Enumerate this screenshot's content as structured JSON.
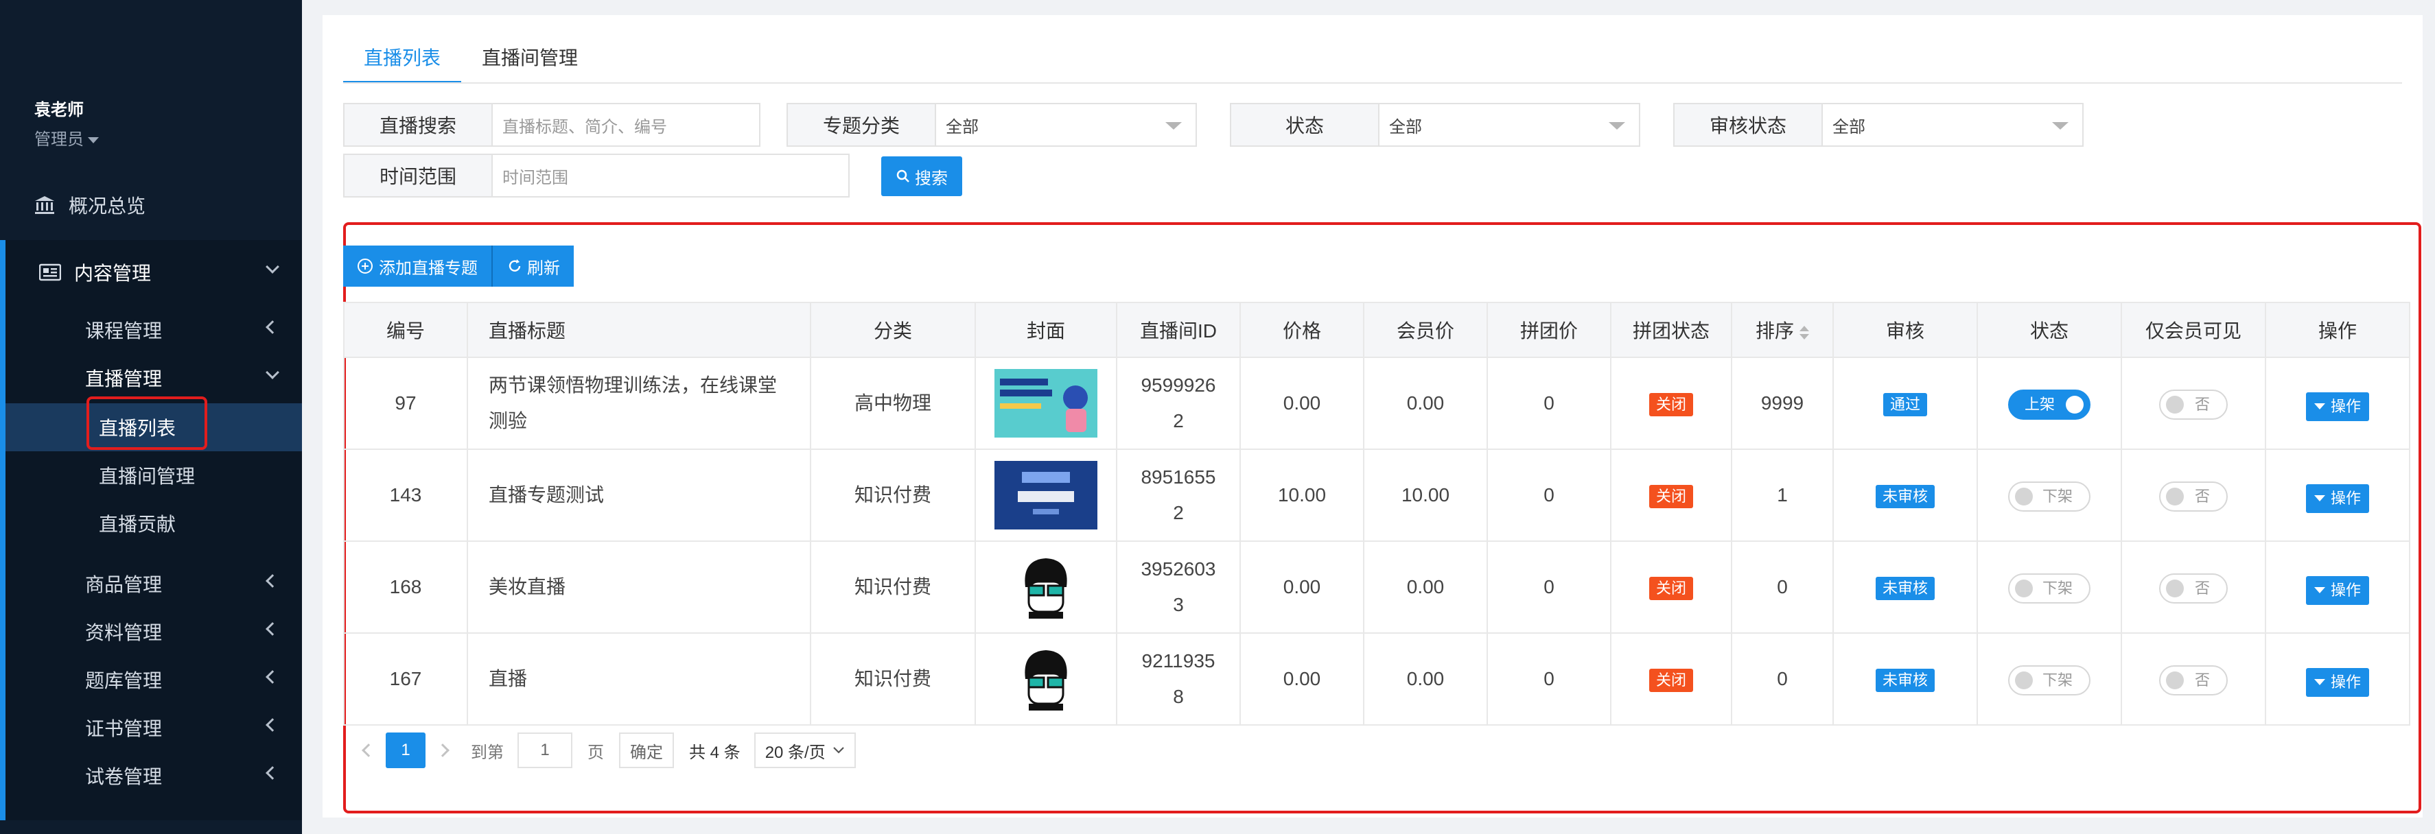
{
  "sidebar": {
    "user_name": "袁老师",
    "user_role": "管理员",
    "overview": "概况总览",
    "content_mgmt": "内容管理",
    "items": {
      "course": "课程管理",
      "live": "直播管理",
      "live_list": "直播列表",
      "live_room": "直播间管理",
      "live_contrib": "直播贡献",
      "goods": "商品管理",
      "material": "资料管理",
      "question": "题库管理",
      "cert": "证书管理",
      "exam": "试卷管理"
    }
  },
  "tabs": {
    "live_list": "直播列表",
    "live_room": "直播间管理"
  },
  "filters": {
    "search_label": "直播搜索",
    "search_placeholder": "直播标题、简介、编号",
    "category_label": "专题分类",
    "category_value": "全部",
    "status_label": "状态",
    "status_value": "全部",
    "audit_label": "审核状态",
    "audit_value": "全部",
    "time_label": "时间范围",
    "time_placeholder": "时间范围",
    "search_button": "搜索"
  },
  "toolbar": {
    "add": "添加直播专题",
    "refresh": "刷新"
  },
  "table": {
    "headers": {
      "id": "编号",
      "title": "直播标题",
      "category": "分类",
      "cover": "封面",
      "room_id": "直播间ID",
      "price": "价格",
      "member_price": "会员价",
      "group_price": "拼团价",
      "group_status": "拼团状态",
      "sort": "排序",
      "audit": "审核",
      "status": "状态",
      "member_only": "仅会员可见",
      "op": "操作"
    },
    "rows": [
      {
        "id": "97",
        "title_l1": "两节课领悟物理训练法，在线课堂",
        "title_l2": "测验",
        "category": "高中物理",
        "room_l1": "9599926",
        "room_l2": "2",
        "price": "0.00",
        "member_price": "0.00",
        "group_price": "0",
        "group_status": "关闭",
        "sort": "9999",
        "audit": "通过",
        "status": "上架",
        "member_only": "否",
        "op": "操作"
      },
      {
        "id": "143",
        "title_l1": "直播专题测试",
        "title_l2": "",
        "category": "知识付费",
        "room_l1": "8951655",
        "room_l2": "2",
        "price": "10.00",
        "member_price": "10.00",
        "group_price": "0",
        "group_status": "关闭",
        "sort": "1",
        "audit": "未审核",
        "status": "下架",
        "member_only": "否",
        "op": "操作"
      },
      {
        "id": "168",
        "title_l1": "美妆直播",
        "title_l2": "",
        "category": "知识付费",
        "room_l1": "3952603",
        "room_l2": "3",
        "price": "0.00",
        "member_price": "0.00",
        "group_price": "0",
        "group_status": "关闭",
        "sort": "0",
        "audit": "未审核",
        "status": "下架",
        "member_only": "否",
        "op": "操作"
      },
      {
        "id": "167",
        "title_l1": "直播",
        "title_l2": "",
        "category": "知识付费",
        "room_l1": "9211935",
        "room_l2": "8",
        "price": "0.00",
        "member_price": "0.00",
        "group_price": "0",
        "group_status": "关闭",
        "sort": "0",
        "audit": "未审核",
        "status": "下架",
        "member_only": "否",
        "op": "操作"
      }
    ]
  },
  "pager": {
    "current": "1",
    "goto_label": "到第",
    "goto_value": "1",
    "page_unit": "页",
    "confirm": "确定",
    "total": "共 4 条",
    "page_size": "20 条/页"
  },
  "colors": {
    "accent": "#1a8ee8",
    "sidebar": "#0e1c2d",
    "tag_red": "#f4511e",
    "highlight_box": "#e21d1d"
  }
}
